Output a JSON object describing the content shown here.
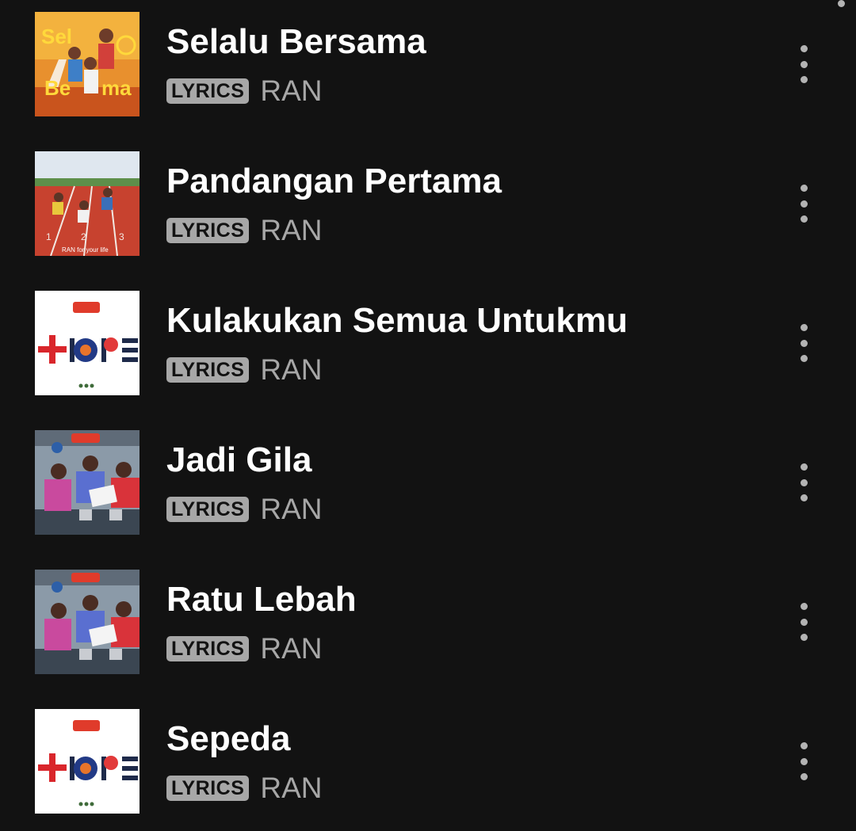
{
  "tracks": [
    {
      "title": "Selalu Bersama",
      "badge": "LYRICS",
      "artist": "RAN",
      "art": "cover-selalu-bersama"
    },
    {
      "title": "Pandangan Pertama",
      "badge": "LYRICS",
      "artist": "RAN",
      "art": "cover-ran-for-your-life"
    },
    {
      "title": "Kulakukan Semua Untukmu",
      "badge": "LYRICS",
      "artist": "RAN",
      "art": "cover-hope"
    },
    {
      "title": "Jadi Gila",
      "badge": "LYRICS",
      "artist": "RAN",
      "art": "cover-band-kitchen"
    },
    {
      "title": "Ratu Lebah",
      "badge": "LYRICS",
      "artist": "RAN",
      "art": "cover-band-kitchen"
    },
    {
      "title": "Sepeda",
      "badge": "LYRICS",
      "artist": "RAN",
      "art": "cover-hope"
    }
  ],
  "album_art_text": {
    "ran_for_your_life": "RAN for your life"
  },
  "colors": {
    "background": "#121212",
    "title": "#ffffff",
    "secondary": "#a7a7a7"
  }
}
